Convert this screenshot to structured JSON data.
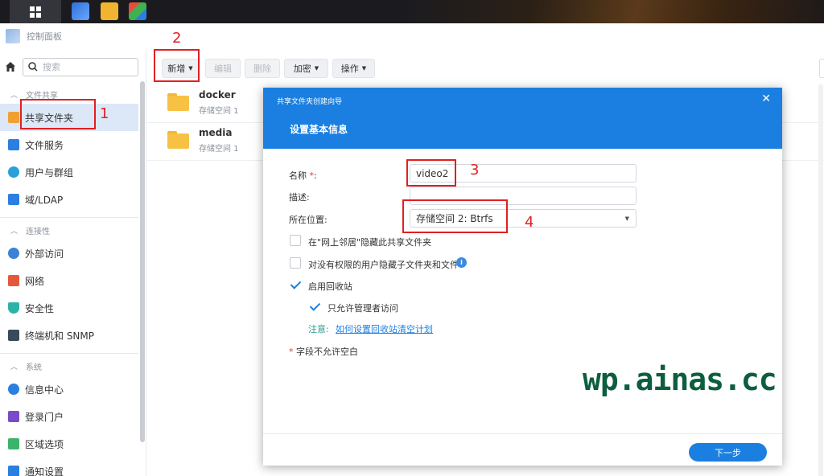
{
  "window": {
    "title": "控制面板"
  },
  "search": {
    "placeholder": "搜索"
  },
  "sidebar": {
    "groups": [
      {
        "label": "文件共享",
        "items": [
          {
            "label": "共享文件夹",
            "icon": "shared-folder-icon",
            "color": "#f0a030",
            "active": true
          },
          {
            "label": "文件服务",
            "icon": "file-services-icon",
            "color": "#2a7fe0"
          },
          {
            "label": "用户与群组",
            "icon": "users-icon",
            "color": "#2aa0d8"
          },
          {
            "label": "域/LDAP",
            "icon": "ldap-icon",
            "color": "#2a7fe0"
          }
        ]
      },
      {
        "label": "连接性",
        "items": [
          {
            "label": "外部访问",
            "icon": "external-access-icon",
            "color": "#3b82d6"
          },
          {
            "label": "网络",
            "icon": "network-icon",
            "color": "#e25a3a"
          },
          {
            "label": "安全性",
            "icon": "security-shield-icon",
            "color": "#2bb3a8"
          },
          {
            "label": "终端机和 SNMP",
            "icon": "terminal-icon",
            "color": "#3a4a5c"
          }
        ]
      },
      {
        "label": "系统",
        "items": [
          {
            "label": "信息中心",
            "icon": "info-center-icon",
            "color": "#2a7fe0"
          },
          {
            "label": "登录门户",
            "icon": "login-portal-icon",
            "color": "#7a4bc8"
          },
          {
            "label": "区域选项",
            "icon": "regional-icon",
            "color": "#3bb36a"
          },
          {
            "label": "通知设置",
            "icon": "notification-icon",
            "color": "#2a7fe0"
          }
        ]
      }
    ]
  },
  "toolbar": {
    "create": "新增",
    "edit": "编辑",
    "delete": "删除",
    "encrypt": "加密",
    "action": "操作"
  },
  "files": [
    {
      "name": "docker",
      "location": "存储空间 1"
    },
    {
      "name": "media",
      "location": "存储空间 1"
    }
  ],
  "dialog": {
    "title": "共享文件夹创建向导",
    "subtitle": "设置基本信息",
    "name_label": "名称",
    "name_req": "*",
    "name_colon": ":",
    "name_value": "video2",
    "desc_label": "描述:",
    "desc_value": "",
    "location_label": "所在位置:",
    "location_value": "存储空间 2:  Btrfs",
    "opt_hide_network": "在\"网上邻居\"隐藏此共享文件夹",
    "opt_hide_subfolders": "对没有权限的用户隐藏子文件夹和文件",
    "opt_recycle": "启用回收站",
    "opt_admin_only": "只允许管理者访问",
    "note_label": "注意:",
    "note_link": "如何设置回收站清空计划",
    "req_star": "*",
    "req_note": " 字段不允许空白",
    "next": "下一步",
    "checks": {
      "hide_network": false,
      "hide_subfolders": false,
      "recycle": true,
      "admin_only": true
    }
  },
  "annotations": {
    "n1": "1",
    "n2": "2",
    "n3": "3",
    "n4": "4"
  },
  "watermark": "wp.ainas.cc"
}
